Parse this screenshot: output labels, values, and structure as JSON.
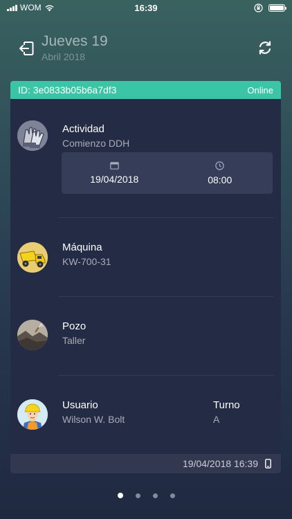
{
  "status_bar": {
    "carrier": "WOM",
    "time": "16:39"
  },
  "header": {
    "day": "Jueves 19",
    "date": "Abril 2018"
  },
  "device": {
    "id": "ID: 3e0833b05b6a7df3",
    "status": "Online"
  },
  "actividad": {
    "title": "Actividad",
    "value": "Comienzo DDH",
    "date": "19/04/2018",
    "time": "08:00",
    "icon": "gloves-icon"
  },
  "maquina": {
    "title": "Máquina",
    "value": "KW-700-31",
    "icon": "dump-truck-icon"
  },
  "pozo": {
    "title": "Pozo",
    "value": "Taller",
    "icon": "mine-pit-icon"
  },
  "usuario": {
    "title": "Usuario",
    "value": "Wilson W. Bolt",
    "turno_title": "Turno",
    "turno_value": "A",
    "icon": "worker-avatar-icon"
  },
  "footer": {
    "timestamp": "19/04/2018 16:39"
  },
  "colors": {
    "accent": "#3ac6a6",
    "card": "#242b45",
    "box": "#353d58"
  },
  "pagination": {
    "total": 4,
    "active": 1
  }
}
